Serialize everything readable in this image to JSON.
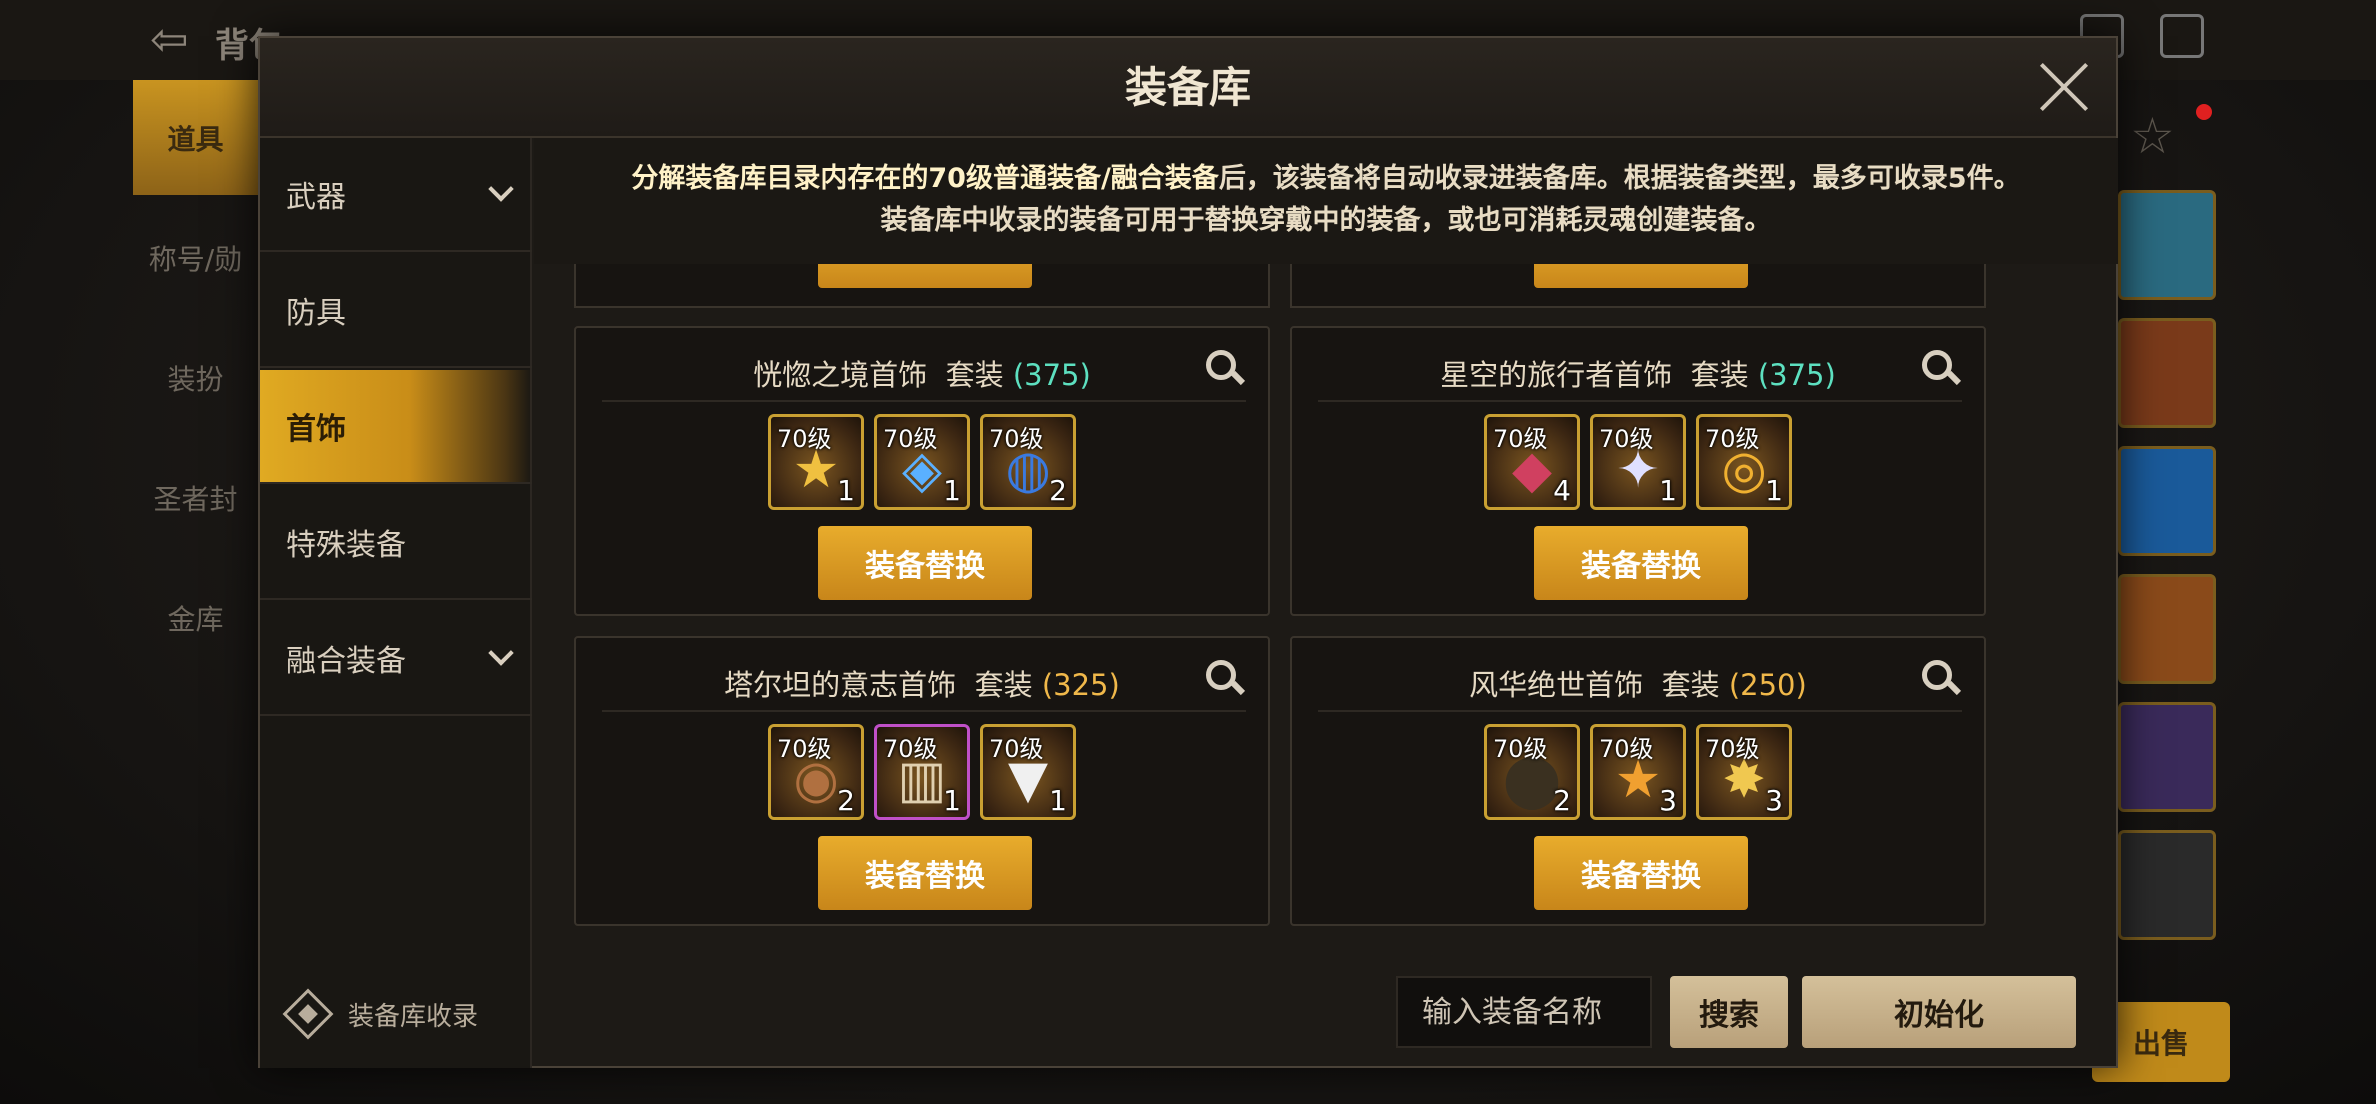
{
  "background": {
    "title": "背包",
    "tabs": [
      "道具",
      "称号/勋",
      "装扮",
      "圣者封",
      "金库"
    ],
    "sell_label": "出售"
  },
  "modal": {
    "title": "装备库",
    "notice": {
      "line1_highlight": "分解装备库目录内存在的70级普通装备/融合装备",
      "line1_rest": "后，该装备将自动收录进装备库。根据装备类型，最多可收录5件。",
      "line2": "装备库中收录的装备可用于替换穿戴中的装备，或也可消耗灵魂创建装备。"
    }
  },
  "sidebar": {
    "items": [
      {
        "label": "武器",
        "expandable": true
      },
      {
        "label": "防具",
        "expandable": false
      },
      {
        "label": "首饰",
        "expandable": false,
        "active": true
      },
      {
        "label": "特殊装备",
        "expandable": false
      },
      {
        "label": "融合装备",
        "expandable": true
      }
    ],
    "footer_label": "装备库收录"
  },
  "cards": [
    {
      "name": "恍惚之境首饰",
      "set_label": "套装",
      "count": "(375)",
      "count_color": "#5de0c0",
      "button": "装备替换",
      "items": [
        {
          "level": "70级",
          "qty": "1",
          "icon": "star-necklace-icon",
          "glyph": "★",
          "color": "#f0c040",
          "rarity": "gold"
        },
        {
          "level": "70级",
          "qty": "1",
          "icon": "gem-pendant-icon",
          "glyph": "◈",
          "color": "#5ab0ff",
          "rarity": "gold"
        },
        {
          "level": "70级",
          "qty": "2",
          "icon": "blue-ring-icon",
          "glyph": "◍",
          "color": "#3a7ae0",
          "rarity": "gold"
        }
      ]
    },
    {
      "name": "星空的旅行者首饰",
      "set_label": "套装",
      "count": "(375)",
      "count_color": "#5de0c0",
      "button": "装备替换",
      "items": [
        {
          "level": "70级",
          "qty": "4",
          "icon": "jewel-amulet-icon",
          "glyph": "◆",
          "color": "#d04060",
          "rarity": "gold"
        },
        {
          "level": "70级",
          "qty": "1",
          "icon": "star-pendant-icon",
          "glyph": "✦",
          "color": "#e0e0ff",
          "rarity": "gold"
        },
        {
          "level": "70级",
          "qty": "1",
          "icon": "gold-ring-icon",
          "glyph": "◎",
          "color": "#f0b030",
          "rarity": "gold"
        }
      ]
    },
    {
      "name": "塔尔坦的意志首饰",
      "set_label": "套装",
      "count": "(325)",
      "count_color": "#f0b84a",
      "button": "装备替换",
      "items": [
        {
          "level": "70级",
          "qty": "2",
          "icon": "grape-ring-icon",
          "glyph": "◉",
          "color": "#b07040",
          "rarity": "gold"
        },
        {
          "level": "70级",
          "qty": "1",
          "icon": "bracelet-icon",
          "glyph": "▥",
          "color": "#e0d0b0",
          "rarity": "purple"
        },
        {
          "level": "70级",
          "qty": "1",
          "icon": "fang-necklace-icon",
          "glyph": "▼",
          "color": "#f0f0f0",
          "rarity": "gold"
        }
      ]
    },
    {
      "name": "风华绝世首饰",
      "set_label": "套装",
      "count": "(250)",
      "count_color": "#f0b84a",
      "button": "装备替换",
      "items": [
        {
          "level": "70级",
          "qty": "2",
          "icon": "dark-ring-icon",
          "glyph": "⬤",
          "color": "#3a3020",
          "rarity": "gold"
        },
        {
          "level": "70级",
          "qty": "3",
          "icon": "star-amulet-icon",
          "glyph": "★",
          "color": "#f0a030",
          "rarity": "gold"
        },
        {
          "level": "70级",
          "qty": "3",
          "icon": "gold-star-icon",
          "glyph": "✸",
          "color": "#f0c850",
          "rarity": "gold"
        }
      ]
    }
  ],
  "bottom": {
    "search_placeholder": "输入装备名称",
    "search_button": "搜索",
    "reset_button": "初始化"
  }
}
